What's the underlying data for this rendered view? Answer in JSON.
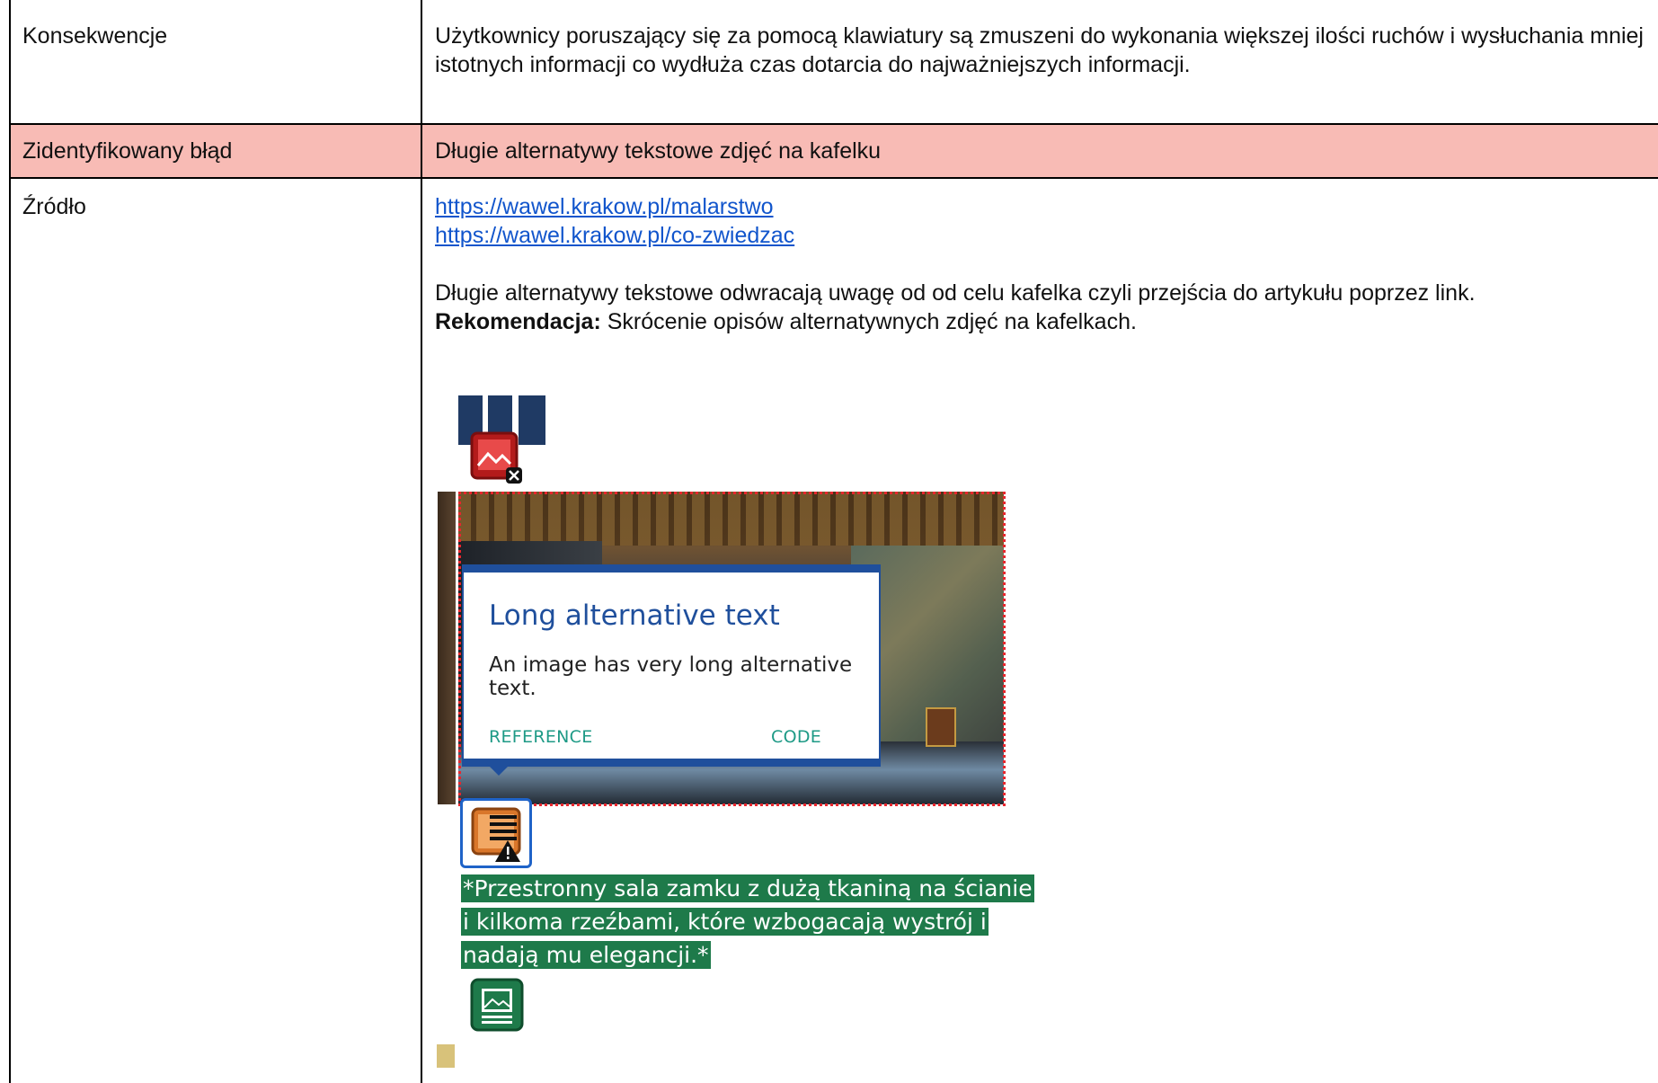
{
  "table": {
    "rows": [
      {
        "label": "Konsekwencje",
        "content": "Użytkownicy poruszający się za pomocą klawiatury są zmuszeni do wykonania większej ilości ruchów i wysłuchania mniej istotnych informacji co wydłuża czas dotarcia do najważniejszych informacji."
      },
      {
        "label": "Zidentyfikowany błąd",
        "content": "Długie alternatywy tekstowe zdjęć na kafelku",
        "highlight_color": "#f8bbb5"
      },
      {
        "label": "Źródło",
        "links": [
          "https://wawel.krakow.pl/malarstwo",
          "https://wawel.krakow.pl/co-zwiedzac"
        ],
        "description": "Długie alternatywy tekstowe odwracają uwagę od od celu kafelka czyli przejścia do artykułu poprzez link.",
        "recommendation_label": "Rekomendacja:",
        "recommendation_text": " Skrócenie opisów alternatywnych zdjęć na kafelkach."
      }
    ]
  },
  "screenshot": {
    "popup": {
      "title": "Long alternative text",
      "body": "An image has very long alternative text.",
      "reference_label": "REFERENCE",
      "code_label": "CODE"
    },
    "alt_text_lines": [
      "*Przestronny sala zamku z dużą tkaniną na ścianie",
      "i kilkoma rzeźbami, które wzbogacają wystrój i",
      "nadają mu elegancji.*"
    ],
    "icons": {
      "image_error": "image-error-icon",
      "long_alt_alert": "long-alt-warning-icon",
      "image_ok": "image-ok-icon"
    },
    "colors": {
      "error_highlight": "#e8262d",
      "popup_accent": "#1f4f9c",
      "alt_text_bg": "#1e7a4a"
    }
  }
}
